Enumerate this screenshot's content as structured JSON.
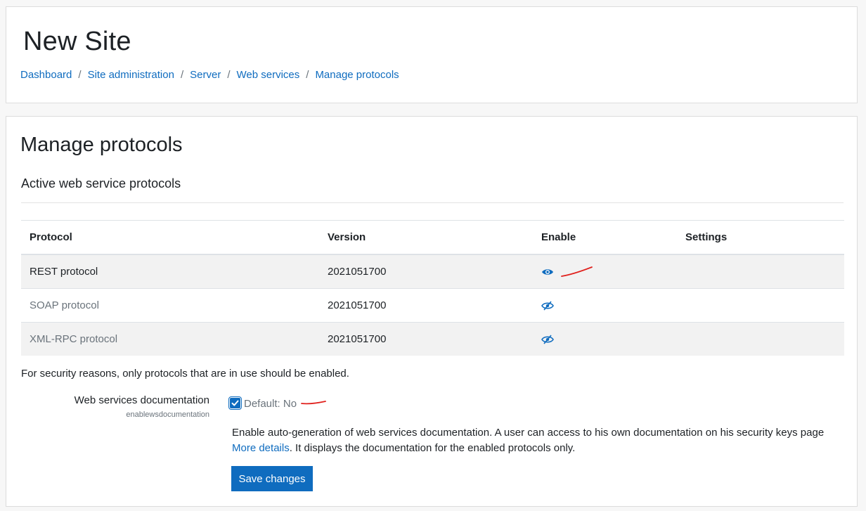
{
  "site": {
    "title": "New Site"
  },
  "breadcrumb": [
    "Dashboard",
    "Site administration",
    "Server",
    "Web services",
    "Manage protocols"
  ],
  "page": {
    "heading": "Manage protocols",
    "subheading": "Active web service protocols"
  },
  "table": {
    "headers": {
      "protocol": "Protocol",
      "version": "Version",
      "enable": "Enable",
      "settings": "Settings"
    },
    "rows": [
      {
        "protocol": "REST protocol",
        "version": "2021051700",
        "enable_icon": "eye-icon",
        "enabled": true
      },
      {
        "protocol": "SOAP protocol",
        "version": "2021051700",
        "enable_icon": "eye-slash-icon",
        "enabled": false
      },
      {
        "protocol": "XML-RPC protocol",
        "version": "2021051700",
        "enable_icon": "eye-slash-icon",
        "enabled": false
      }
    ]
  },
  "security_note": "For security reasons, only protocols that are in use should be enabled.",
  "setting": {
    "label": "Web services documentation",
    "key": "enablewsdocumentation",
    "checked": true,
    "default_text": "Default: No",
    "description_before": "Enable auto-generation of web services documentation. A user can access to his own documentation on his security keys page ",
    "description_link": "More details",
    "description_after": ". It displays the documentation for the enabled protocols only."
  },
  "save_button": "Save changes",
  "colors": {
    "accent": "#0f6cbf",
    "annotation": "#e0201c"
  }
}
